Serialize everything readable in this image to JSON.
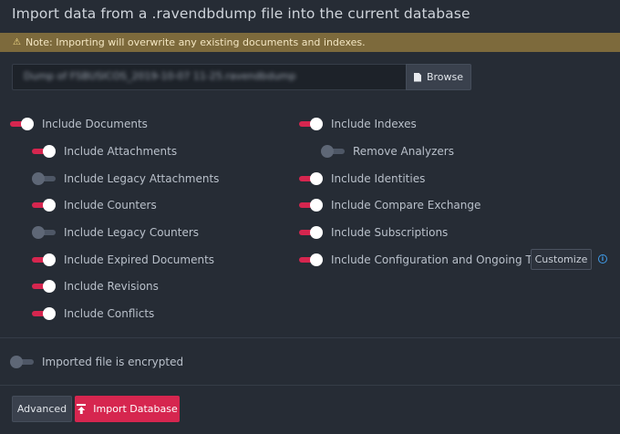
{
  "page": {
    "title": "Import data from a .ravendbdump file into the current database"
  },
  "warning": {
    "icon": "warning-triangle-icon",
    "text": "Note: Importing will overwrite any existing documents and indexes."
  },
  "file": {
    "value": "Dump of FSBUSICOS_2019-10-07 11-25.ravendbdump",
    "browse_label": "Browse"
  },
  "options_left": [
    {
      "label": "Include Documents",
      "on": true
    },
    {
      "label": "Include Attachments",
      "on": true
    },
    {
      "label": "Include Legacy Attachments",
      "on": false
    },
    {
      "label": "Include Counters",
      "on": true
    },
    {
      "label": "Include Legacy Counters",
      "on": false
    },
    {
      "label": "Include Expired Documents",
      "on": true
    },
    {
      "label": "Include Revisions",
      "on": true
    },
    {
      "label": "Include Conflicts",
      "on": true
    }
  ],
  "options_right": [
    {
      "label": "Include Indexes",
      "on": true
    },
    {
      "label": "Remove Analyzers",
      "on": false
    },
    {
      "label": "Include Identities",
      "on": true
    },
    {
      "label": "Include Compare Exchange",
      "on": true
    },
    {
      "label": "Include Subscriptions",
      "on": true
    },
    {
      "label": "Include Configuration and Ongoing Tasks",
      "on": true
    }
  ],
  "customize_label": "Customize",
  "encrypted": {
    "label": "Imported file is encrypted",
    "on": false
  },
  "actions": {
    "advanced_label": "Advanced",
    "import_label": "Import Database"
  },
  "colors": {
    "accent": "#d6264f",
    "warning_bg": "#7d6a3c",
    "background": "#262c35"
  }
}
